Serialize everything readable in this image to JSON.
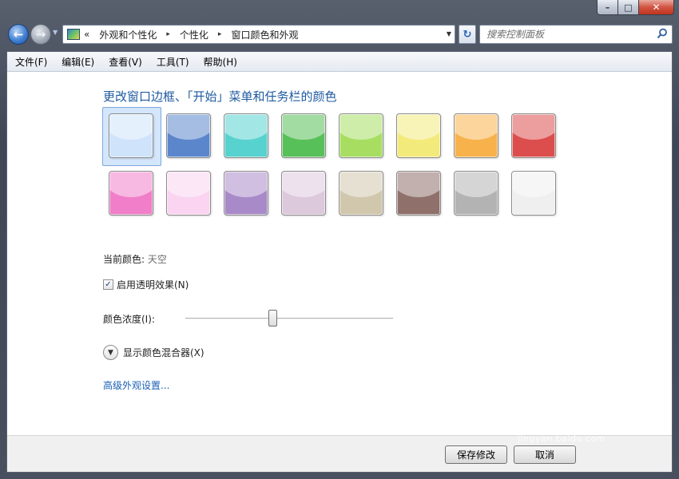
{
  "window": {
    "caption": {
      "minimize": "–",
      "maximize": "□",
      "close": "✕"
    }
  },
  "nav": {
    "back_glyph": "←",
    "forward_glyph": "→",
    "address": {
      "overflow": "«",
      "crumbs": [
        "外观和个性化",
        "个性化",
        "窗口颜色和外观"
      ],
      "separator": "▸"
    },
    "refresh_glyph": "↻",
    "search": {
      "placeholder": "搜索控制面板"
    }
  },
  "menubar": {
    "items": [
      "文件(F)",
      "编辑(E)",
      "查看(V)",
      "工具(T)",
      "帮助(H)"
    ]
  },
  "main": {
    "heading": "更改窗口边框、「开始」菜单和任务栏的颜色",
    "swatches": [
      {
        "color": "#cfe3fb",
        "selected": true
      },
      {
        "color": "#5b86cc"
      },
      {
        "color": "#57d2cf"
      },
      {
        "color": "#58c058"
      },
      {
        "color": "#a7de62"
      },
      {
        "color": "#f3ea7c"
      },
      {
        "color": "#f8b24c"
      },
      {
        "color": "#dc4e4e"
      },
      {
        "color": "#f07ec8"
      },
      {
        "color": "#fad4f1"
      },
      {
        "color": "#a98ac8"
      },
      {
        "color": "#dcc9dc"
      },
      {
        "color": "#d1c7ad"
      },
      {
        "color": "#8f706a"
      },
      {
        "color": "#b3b3b3"
      },
      {
        "color": "#efefef"
      }
    ],
    "current_color_label": "当前颜色:",
    "current_color_value": "天空",
    "transparency_label": "启用透明效果(N)",
    "transparency_checked": true,
    "intensity_label": "颜色浓度(I):",
    "intensity_value": 0.42,
    "mixer_label": "显示颜色混合器(X)",
    "advanced_link": "高级外观设置..."
  },
  "footer": {
    "save_label": "保存修改",
    "cancel_label": "取消"
  },
  "watermark": {
    "brand": "Baidu经验",
    "url": "jingyan.baidu.com"
  }
}
